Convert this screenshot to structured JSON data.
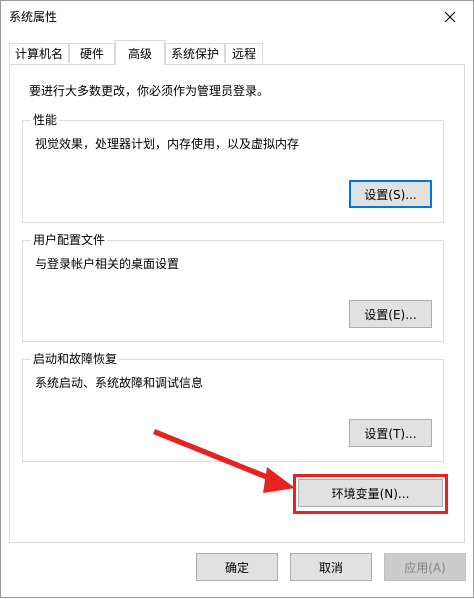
{
  "window": {
    "title": "系统属性"
  },
  "tabs": [
    {
      "label": "计算机名"
    },
    {
      "label": "硬件"
    },
    {
      "label": "高级",
      "active": true
    },
    {
      "label": "系统保护"
    },
    {
      "label": "远程"
    }
  ],
  "advanced": {
    "admin_note": "要进行大多数更改，你必须作为管理员登录。",
    "performance": {
      "title": "性能",
      "description": "视觉效果，处理器计划，内存使用，以及虚拟内存",
      "button": "设置(S)..."
    },
    "user_profiles": {
      "title": "用户配置文件",
      "description": "与登录帐户相关的桌面设置",
      "button": "设置(E)..."
    },
    "startup_recovery": {
      "title": "启动和故障恢复",
      "description": "系统启动、系统故障和调试信息",
      "button": "设置(T)..."
    },
    "env_vars_button": "环境变量(N)..."
  },
  "footer": {
    "ok": "确定",
    "cancel": "取消",
    "apply": "应用(A)"
  },
  "colors": {
    "annotation": "#e8231f",
    "focus": "#0078d7"
  }
}
